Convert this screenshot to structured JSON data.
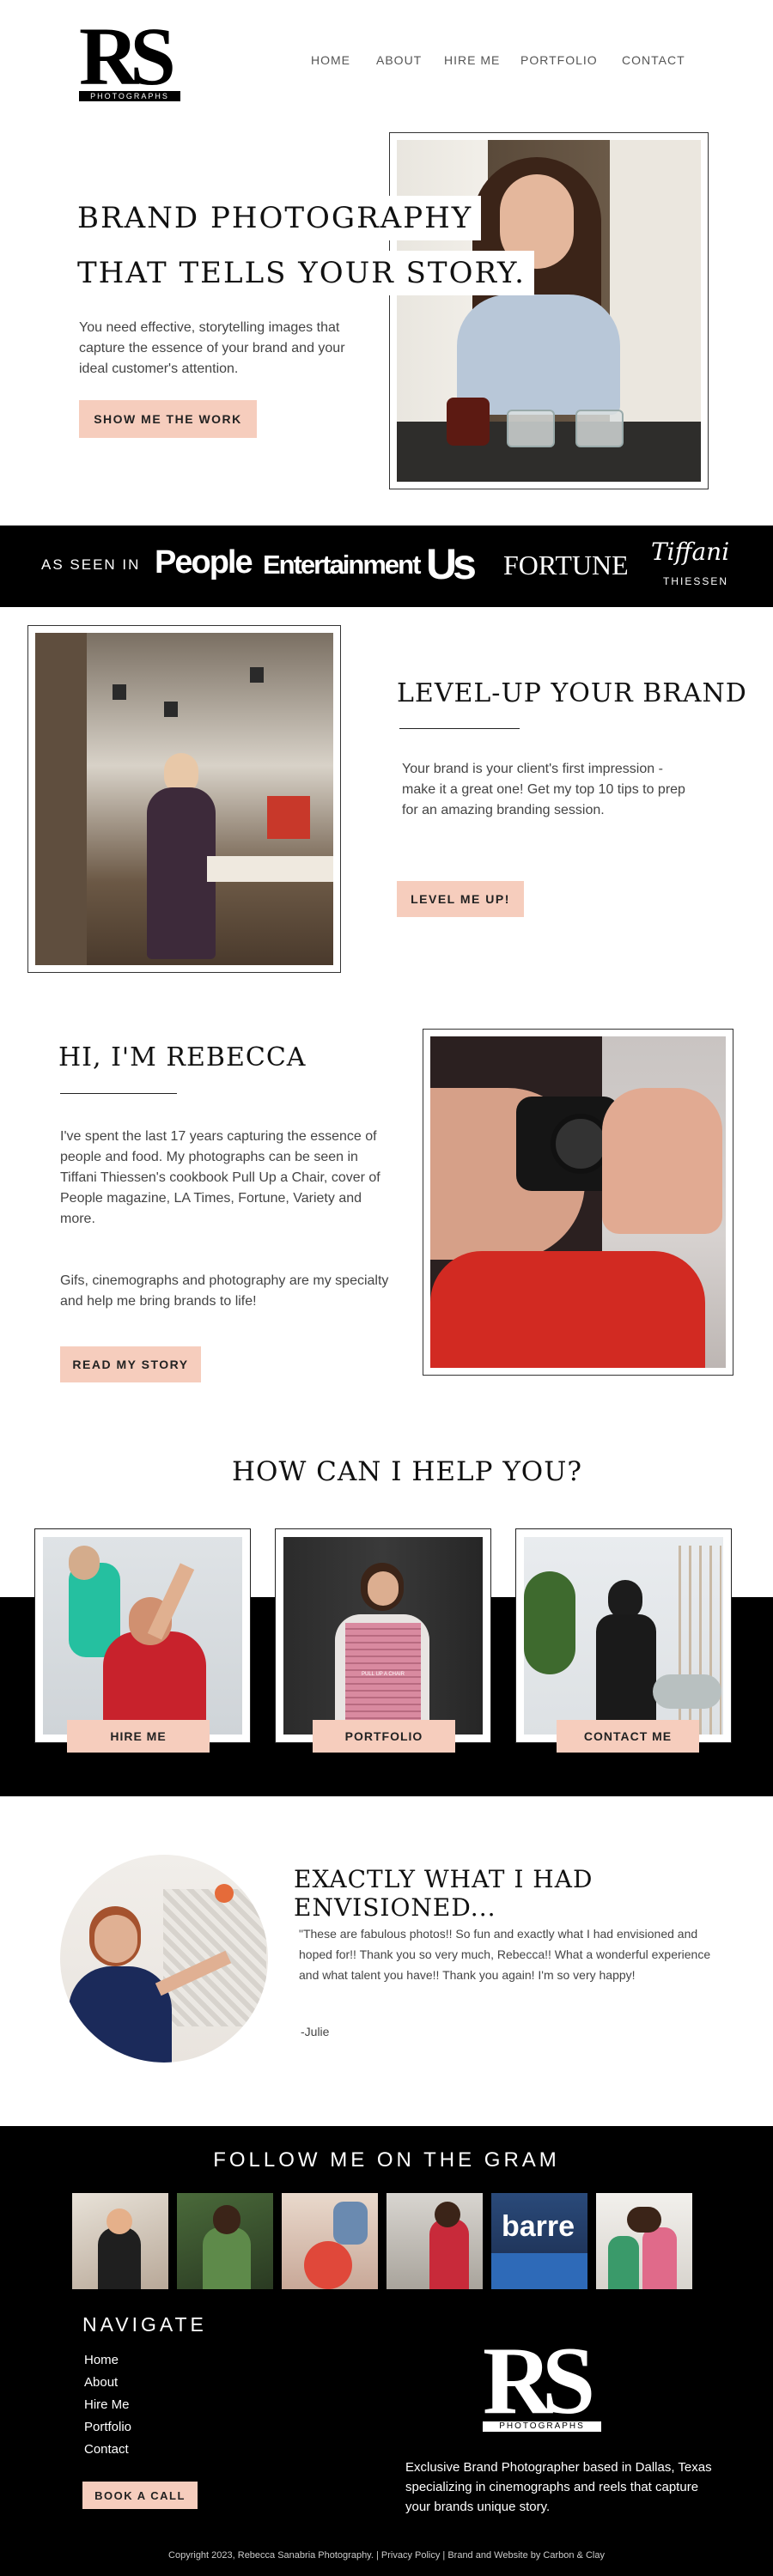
{
  "header": {
    "logo_main": "RS",
    "logo_sub": "PHOTOGRAPHS",
    "nav": [
      "HOME",
      "ABOUT",
      "HIRE ME",
      "PORTFOLIO",
      "CONTACT"
    ]
  },
  "hero": {
    "headline_1": "BRAND PHOTOGRAPHY",
    "headline_2": "THAT TELLS YOUR STORY.",
    "body": "You need effective, storytelling images that capture the essence of your brand and your ideal customer's attention.",
    "cta": "SHOW ME THE WORK"
  },
  "press": {
    "label": "AS SEEN IN",
    "logos": [
      "People",
      "Entertainment",
      "Us",
      "FORTUNE",
      "Tiffani",
      "THIESSEN"
    ]
  },
  "levelup": {
    "title": "LEVEL-UP YOUR BRAND",
    "body": "Your brand is your client's first impression - make it a great one! Get my top 10 tips to prep for an amazing branding session.",
    "cta": "LEVEL ME UP!"
  },
  "about": {
    "title": "HI, I'M REBECCA",
    "body_1": "I've spent the last 17 years capturing the essence of people and food. My photographs can be seen in Tiffani Thiessen's cookbook Pull Up a Chair, cover of People magazine, LA Times, Fortune, Variety and more.",
    "body_2": "Gifs, cinemographs and photography are my specialty and help me bring brands to life!",
    "cta": "READ MY STORY"
  },
  "help": {
    "title": "HOW CAN I HELP YOU?",
    "cards": [
      "HIRE ME",
      "PORTFOLIO",
      "CONTACT ME"
    ],
    "book_text": "PULL UP A CHAIR"
  },
  "testimonial": {
    "title": "EXACTLY WHAT I HAD ENVISIONED...",
    "quote": "\"These are fabulous photos!! So fun and exactly what I had envisioned and hoped for!! Thank you so very much, Rebecca!! What a wonderful experience and what talent you have!! Thank you again! I'm so very happy!",
    "author": "-Julie"
  },
  "footer": {
    "gram_title": "FOLLOW ME ON THE GRAM",
    "gram_shirt": "barre",
    "nav_title": "NAVIGATE",
    "links": [
      "Home",
      "About",
      "Hire Me",
      "Portfolio",
      "Contact"
    ],
    "cta": "BOOK A CALL",
    "logo_main": "RS",
    "logo_sub": "PHOTOGRAPHS",
    "blurb": "Exclusive Brand Photographer based in Dallas, Texas specializing in cinemographs and reels that capture your brands unique story.",
    "copyright": "Copyright 2023, Rebecca Sanabria Photography.  | Privacy Policy | Brand and Website by Carbon & Clay"
  },
  "colors": {
    "accent": "#f6cdbd",
    "black": "#000000",
    "text": "#444444"
  }
}
